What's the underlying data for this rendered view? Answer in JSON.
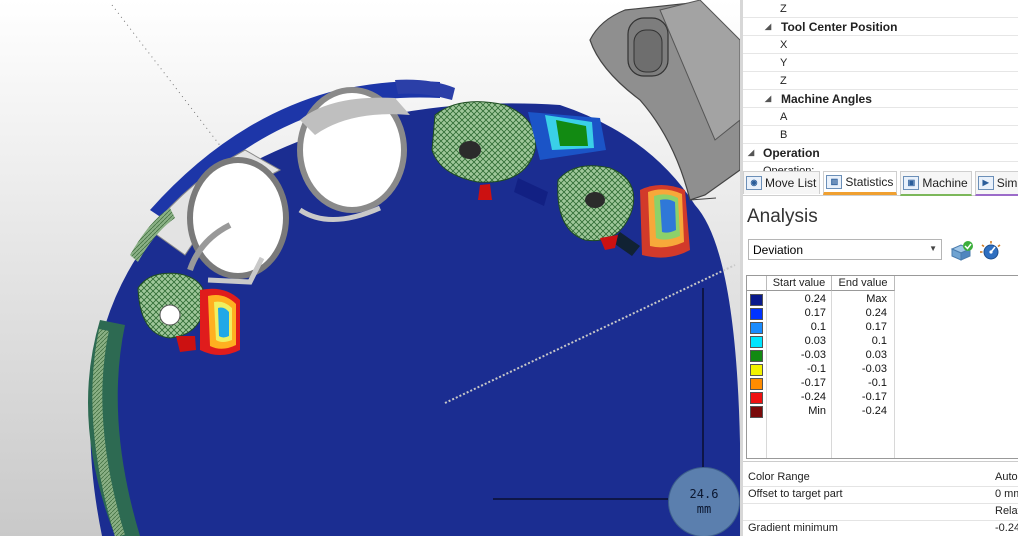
{
  "scale_badge": {
    "value": "24.6",
    "unit": "mm"
  },
  "properties": {
    "rows": [
      {
        "label": "Z",
        "kind": "item"
      },
      {
        "label": "Tool Center Position",
        "kind": "category"
      },
      {
        "label": "X",
        "kind": "item"
      },
      {
        "label": "Y",
        "kind": "item"
      },
      {
        "label": "Z",
        "kind": "item"
      },
      {
        "label": "Machine Angles",
        "kind": "category"
      },
      {
        "label": "A",
        "kind": "item"
      },
      {
        "label": "B",
        "kind": "item"
      },
      {
        "label": "Operation",
        "kind": "section"
      },
      {
        "label": "Operation:",
        "kind": "sub"
      }
    ]
  },
  "tabs": [
    {
      "label": "Move List",
      "icon": "move-list-icon",
      "color": "#3a7fc4"
    },
    {
      "label": "Statistics",
      "icon": "statistics-icon",
      "color": "#f0a030",
      "active": true
    },
    {
      "label": "Machine",
      "icon": "machine-icon",
      "color": "#7cb75a"
    },
    {
      "label": "Simul",
      "icon": "simulation-icon",
      "color": "#9b6bc9"
    }
  ],
  "analysis": {
    "title": "Analysis",
    "mode": "Deviation",
    "headers": {
      "start": "Start value",
      "end": "End value"
    },
    "ranges": [
      {
        "color": "#0a1a8c",
        "start": "0.24",
        "end": "Max"
      },
      {
        "color": "#0033ff",
        "start": "0.17",
        "end": "0.24"
      },
      {
        "color": "#1a8cff",
        "start": "0.1",
        "end": "0.17"
      },
      {
        "color": "#00e5ff",
        "start": "0.03",
        "end": "0.1"
      },
      {
        "color": "#128a12",
        "start": "-0.03",
        "end": "0.03"
      },
      {
        "color": "#f2f200",
        "start": "-0.1",
        "end": "-0.03"
      },
      {
        "color": "#ff8c00",
        "start": "-0.17",
        "end": "-0.1"
      },
      {
        "color": "#ee1111",
        "start": "-0.24",
        "end": "-0.17"
      },
      {
        "color": "#7a0a0a",
        "start": "Min",
        "end": "-0.24"
      }
    ],
    "settings": [
      {
        "key": "Color Range",
        "value": "Auto"
      },
      {
        "key": "Offset to target part",
        "value": "0 mm"
      },
      {
        "key": "",
        "value": "Relat"
      },
      {
        "key": "Gradient minimum",
        "value": "-0.24"
      }
    ]
  }
}
